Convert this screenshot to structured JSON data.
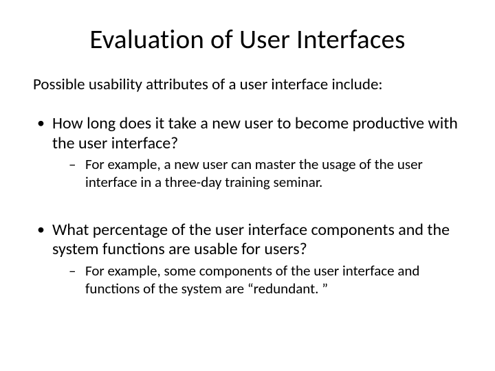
{
  "title": "Evaluation of User Interfaces",
  "intro": "Possible usability attributes of a user interface include:",
  "bullets": [
    {
      "text": "How long does it take a new user to become productive with the user interface?",
      "sub": [
        "For example, a new user can master the usage of  the user interface in a three-day training seminar."
      ]
    },
    {
      "text": "What percentage of the user interface components and the system functions are usable for users?",
      "sub": [
        "For example, some components of the user interface and functions of the system are “redundant. ”"
      ]
    }
  ]
}
